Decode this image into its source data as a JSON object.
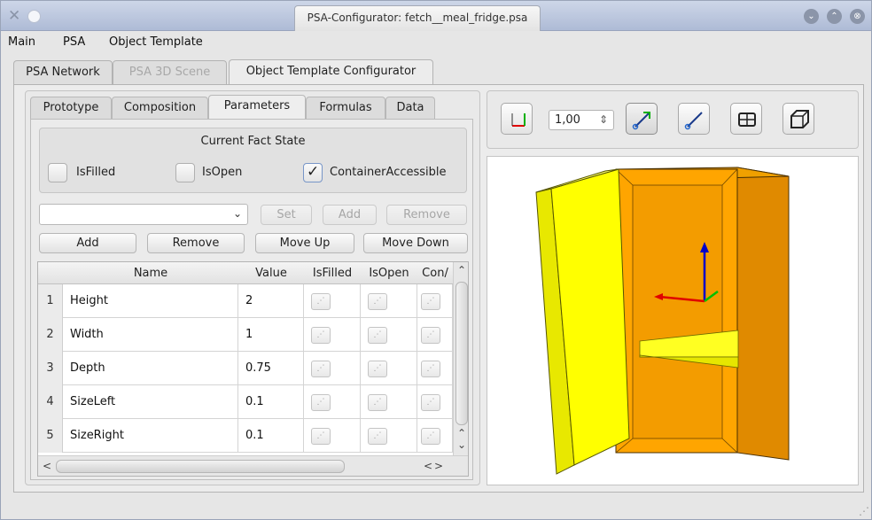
{
  "window": {
    "title": "PSA-Configurator: fetch__meal_fridge.psa",
    "close_glyph": "⊗",
    "min_glyph": "⌄",
    "max_glyph": "⌃"
  },
  "menu": [
    "Main",
    "PSA",
    "Object Template"
  ],
  "outer_tabs": [
    "PSA Network",
    "PSA 3D Scene",
    "Object Template Configurator"
  ],
  "inner_tabs": [
    "Prototype",
    "Composition",
    "Parameters",
    "Formulas",
    "Data"
  ],
  "fact_state": {
    "title": "Current Fact State",
    "checkboxes": [
      {
        "label": "IsFilled",
        "checked": false
      },
      {
        "label": "IsOpen",
        "checked": false
      },
      {
        "label": "ContainerAccessible",
        "checked": true
      }
    ]
  },
  "controls": {
    "combo_value": "",
    "set": "Set",
    "add_top": "Add",
    "remove_top": "Remove",
    "add": "Add",
    "remove": "Remove",
    "move_up": "Move Up",
    "move_down": "Move Down"
  },
  "table": {
    "headers": [
      "Name",
      "Value",
      "IsFilled",
      "IsOpen",
      "Con/"
    ],
    "rows": [
      {
        "num": "1",
        "name": "Height",
        "value": "2"
      },
      {
        "num": "2",
        "name": "Width",
        "value": "1"
      },
      {
        "num": "3",
        "name": "Depth",
        "value": "0.75"
      },
      {
        "num": "4",
        "name": "SizeLeft",
        "value": "0.1"
      },
      {
        "num": "5",
        "name": "SizeRight",
        "value": "0.1"
      }
    ]
  },
  "viewer": {
    "scale_value": "1,00",
    "colors": {
      "cabinet": "#ffa500",
      "door": "#ffff00",
      "axis_x": "#e00000",
      "axis_y": "#00c000",
      "axis_z": "#0000c8"
    }
  }
}
